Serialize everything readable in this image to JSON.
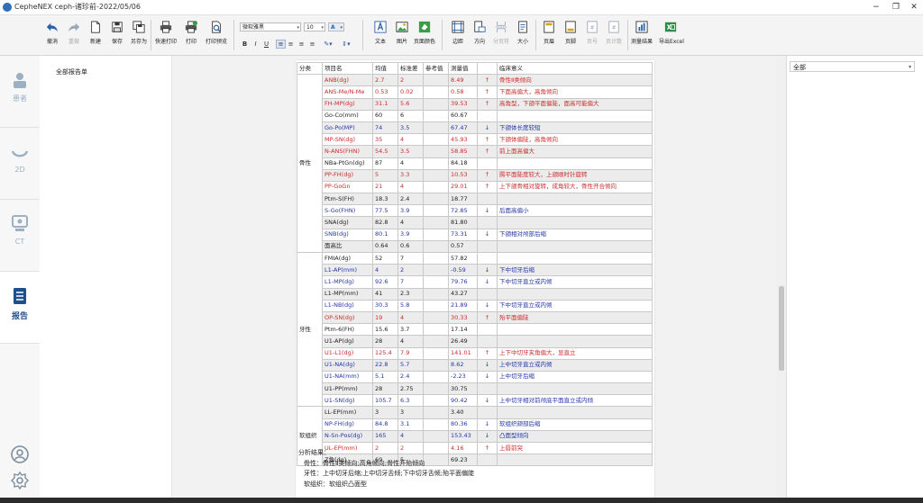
{
  "window": {
    "title": "CepheNEX  ceph-诸珍前-2022/05/06",
    "minimize": "−",
    "restore": "❐",
    "close": "✕"
  },
  "toolbar": {
    "undo": "撤消",
    "redo": "重做",
    "new": "新建",
    "save": "保存",
    "save_as": "另存为",
    "quick_print": "快速打印",
    "print": "打印",
    "print_preview": "打印预览",
    "font_name": "微软雅黑",
    "font_size": "10",
    "bold": "B",
    "italic": "I",
    "underline": "U",
    "text": "文本",
    "image": "图片",
    "page_color": "页面颜色",
    "border": "边距",
    "orientation": "方向",
    "page_break": "分页符",
    "size": "大小",
    "header": "页眉",
    "footer": "页脚",
    "page_number": "页号",
    "page_count": "页计数",
    "measure_result": "测量结果",
    "export_excel": "导出Excel"
  },
  "sidebar": {
    "items": [
      {
        "label": "患者",
        "icon": "patient-icon"
      },
      {
        "label": "2D",
        "icon": "2d-icon"
      },
      {
        "label": "CT",
        "icon": "ct-icon"
      },
      {
        "label": "报告",
        "icon": "report-icon",
        "active": true
      }
    ],
    "bottom_icons": [
      "user-icon",
      "settings-icon"
    ]
  },
  "tree": {
    "root": "全部报告单"
  },
  "filter": {
    "value": "全部"
  },
  "report": {
    "headers": [
      "分类",
      "项目名",
      "均值",
      "标准差",
      "参考值",
      "测量值",
      "",
      "临床意义"
    ],
    "groups": [
      {
        "category": "骨性",
        "rows": [
          {
            "name": "ANB(dg)",
            "mean": "2.7",
            "sd": "2",
            "ref": "",
            "value": "8.49",
            "arrow": "↑",
            "meaning": "骨性Ⅱ类倾向",
            "status": "up"
          },
          {
            "name": "ANS-Me/N-Me",
            "mean": "0.53",
            "sd": "0.02",
            "ref": "",
            "value": "0.58",
            "arrow": "↑",
            "meaning": "下面高偏大，高角倾向",
            "status": "up"
          },
          {
            "name": "FH-MP(dg)",
            "mean": "31.1",
            "sd": "5.6",
            "ref": "",
            "value": "39.53",
            "arrow": "↑",
            "meaning": "高角型，下颌平面偏陡，面高可能偏大",
            "status": "up"
          },
          {
            "name": "Go-Co(mm)",
            "mean": "60",
            "sd": "6",
            "ref": "",
            "value": "60.67",
            "arrow": "",
            "meaning": "",
            "status": "normal"
          },
          {
            "name": "Go-Po(MP)",
            "mean": "74",
            "sd": "3.5",
            "ref": "",
            "value": "67.47",
            "arrow": "↓",
            "meaning": "下颌体长度较短",
            "status": "down"
          },
          {
            "name": "MP-SN(dg)",
            "mean": "35",
            "sd": "4",
            "ref": "",
            "value": "45.93",
            "arrow": "↑",
            "meaning": "下颌体偏陡，高角倾向",
            "status": "up"
          },
          {
            "name": "N-ANS(FHN)",
            "mean": "54.5",
            "sd": "3.5",
            "ref": "",
            "value": "58.85",
            "arrow": "↑",
            "meaning": "前上面高偏大",
            "status": "up"
          },
          {
            "name": "NBa-PtGn(dg)",
            "mean": "87",
            "sd": "4",
            "ref": "",
            "value": "84.18",
            "arrow": "",
            "meaning": "",
            "status": "normal"
          },
          {
            "name": "PP-FH(dg)",
            "mean": "5",
            "sd": "3.3",
            "ref": "",
            "value": "10.53",
            "arrow": "↑",
            "meaning": "腭平面陡度较大，上颌顺时针旋转",
            "status": "up"
          },
          {
            "name": "PP-GoGn",
            "mean": "21",
            "sd": "4",
            "ref": "",
            "value": "29.01",
            "arrow": "↑",
            "meaning": "上下颌骨相对旋转，成角较大，骨性开合倾向",
            "status": "up"
          },
          {
            "name": "Ptm-S(FH)",
            "mean": "18.3",
            "sd": "2.4",
            "ref": "",
            "value": "18.77",
            "arrow": "",
            "meaning": "",
            "status": "normal"
          },
          {
            "name": "S-Go(FHN)",
            "mean": "77.5",
            "sd": "3.9",
            "ref": "",
            "value": "72.85",
            "arrow": "↓",
            "meaning": "后面高偏小",
            "status": "down"
          },
          {
            "name": "SNA(dg)",
            "mean": "82.8",
            "sd": "4",
            "ref": "",
            "value": "81.80",
            "arrow": "",
            "meaning": "",
            "status": "normal"
          },
          {
            "name": "SNB(dg)",
            "mean": "80.1",
            "sd": "3.9",
            "ref": "",
            "value": "73.31",
            "arrow": "↓",
            "meaning": "下颌相对颅部后缩",
            "status": "down"
          },
          {
            "name": "面高比",
            "mean": "0.64",
            "sd": "0.6",
            "ref": "",
            "value": "0.57",
            "arrow": "",
            "meaning": "",
            "status": "normal"
          }
        ]
      },
      {
        "category": "牙性",
        "rows": [
          {
            "name": "FMIA(dg)",
            "mean": "52",
            "sd": "7",
            "ref": "",
            "value": "57.82",
            "arrow": "",
            "meaning": "",
            "status": "normal"
          },
          {
            "name": "L1-AP(mm)",
            "mean": "4",
            "sd": "2",
            "ref": "",
            "value": "-0.59",
            "arrow": "↓",
            "meaning": "下中切牙后缩",
            "status": "down"
          },
          {
            "name": "L1-MP(dg)",
            "mean": "92.6",
            "sd": "7",
            "ref": "",
            "value": "79.76",
            "arrow": "↓",
            "meaning": "下中切牙直立或内倾",
            "status": "down"
          },
          {
            "name": "L1-MP(mm)",
            "mean": "41",
            "sd": "2.3",
            "ref": "",
            "value": "43.27",
            "arrow": "",
            "meaning": "",
            "status": "normal"
          },
          {
            "name": "L1-NB(dg)",
            "mean": "30.3",
            "sd": "5.8",
            "ref": "",
            "value": "21.89",
            "arrow": "↓",
            "meaning": "下中切牙直立或内倾",
            "status": "down"
          },
          {
            "name": "OP-SN(dg)",
            "mean": "19",
            "sd": "4",
            "ref": "",
            "value": "30.33",
            "arrow": "↑",
            "meaning": "殆平面偏陡",
            "status": "up"
          },
          {
            "name": "Ptm-6(FH)",
            "mean": "15.6",
            "sd": "3.7",
            "ref": "",
            "value": "17.14",
            "arrow": "",
            "meaning": "",
            "status": "normal"
          },
          {
            "name": "U1-AP(dg)",
            "mean": "28",
            "sd": "4",
            "ref": "",
            "value": "26.49",
            "arrow": "",
            "meaning": "",
            "status": "normal"
          },
          {
            "name": "U1-L1(dg)",
            "mean": "125.4",
            "sd": "7.9",
            "ref": "",
            "value": "141.01",
            "arrow": "↑",
            "meaning": "上下中切牙夹角偏大，显直立",
            "status": "up"
          },
          {
            "name": "U1-NA(dg)",
            "mean": "22.8",
            "sd": "5.7",
            "ref": "",
            "value": "8.62",
            "arrow": "↓",
            "meaning": "上中切牙直立或内倾",
            "status": "down"
          },
          {
            "name": "U1-NA(mm)",
            "mean": "5.1",
            "sd": "2.4",
            "ref": "",
            "value": "-2.23",
            "arrow": "↓",
            "meaning": "上中切牙后缩",
            "status": "down"
          },
          {
            "name": "U1-PP(mm)",
            "mean": "28",
            "sd": "2.75",
            "ref": "",
            "value": "30.75",
            "arrow": "",
            "meaning": "",
            "status": "normal"
          },
          {
            "name": "U1-SN(dg)",
            "mean": "105.7",
            "sd": "6.3",
            "ref": "",
            "value": "90.42",
            "arrow": "↓",
            "meaning": "上中切牙相对前颅底平面直立或内倾",
            "status": "down"
          }
        ]
      },
      {
        "category": "软组织",
        "rows": [
          {
            "name": "LL-EP(mm)",
            "mean": "3",
            "sd": "3",
            "ref": "",
            "value": "3.40",
            "arrow": "",
            "meaning": "",
            "status": "normal"
          },
          {
            "name": "NP-FH(dg)",
            "mean": "84.8",
            "sd": "3.1",
            "ref": "",
            "value": "80.36",
            "arrow": "↓",
            "meaning": "软组织颏部后缩",
            "status": "down"
          },
          {
            "name": "N-Sn-Pos(dg)",
            "mean": "165",
            "sd": "4",
            "ref": "",
            "value": "153.43",
            "arrow": "↓",
            "meaning": "凸面型倾向",
            "status": "down"
          },
          {
            "name": "UL-EP(mm)",
            "mean": "2",
            "sd": "2",
            "ref": "",
            "value": "4.16",
            "arrow": "↑",
            "meaning": "上唇前突",
            "status": "up"
          },
          {
            "name": "Z角(dg)",
            "mean": "69",
            "sd": "5",
            "ref": "",
            "value": "69.23",
            "arrow": "",
            "meaning": "",
            "status": "normal"
          }
        ]
      }
    ],
    "analysis": {
      "title": "分析结果：",
      "lines": [
        "骨性：骨性Ⅱ类倾向;高角倾向;骨性开殆倾向",
        "牙性：上中切牙后缩;上中切牙舌倾;下中切牙舌倾;殆平面偏陡",
        "软组织：软组织凸面型"
      ]
    }
  },
  "colors": {
    "up": "#cc2c2c",
    "down": "#2636a8",
    "accent": "#1f4e8c"
  }
}
